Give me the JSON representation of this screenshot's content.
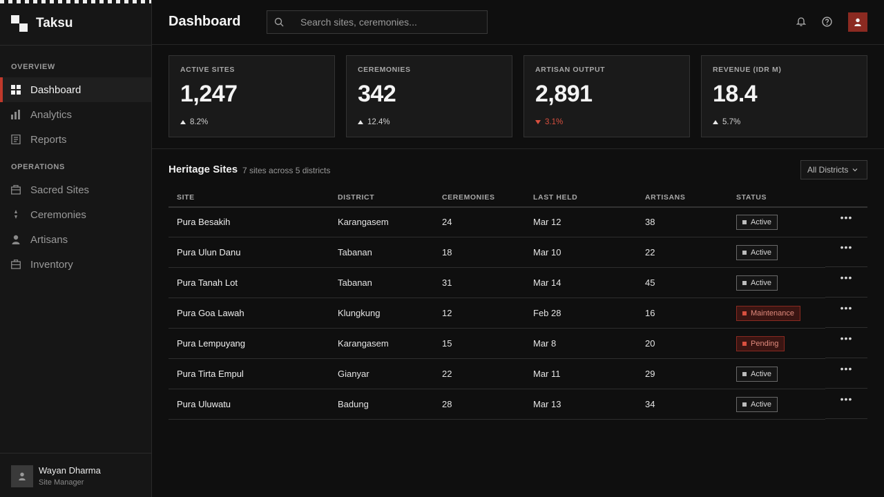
{
  "brand": {
    "name": "Taksu"
  },
  "nav": {
    "overview_label": "OVERVIEW",
    "operations_label": "OPERATIONS",
    "items": [
      {
        "label": "Dashboard",
        "icon": "grid-icon",
        "active": true
      },
      {
        "label": "Analytics",
        "icon": "bar-chart-icon"
      },
      {
        "label": "Reports",
        "icon": "document-icon"
      },
      {
        "label": "Sacred Sites",
        "icon": "temple-icon"
      },
      {
        "label": "Ceremonies",
        "icon": "flame-icon"
      },
      {
        "label": "Artisans",
        "icon": "person-icon"
      },
      {
        "label": "Inventory",
        "icon": "box-icon"
      }
    ]
  },
  "user": {
    "name": "Wayan Dharma",
    "role": "Site Manager"
  },
  "header": {
    "title": "Dashboard",
    "search_placeholder": "Search sites, ceremonies..."
  },
  "kpis": [
    {
      "label": "ACTIVE SITES",
      "value": "1,247",
      "delta": "8.2%",
      "direction": "up"
    },
    {
      "label": "CEREMONIES",
      "value": "342",
      "delta": "12.4%",
      "direction": "up"
    },
    {
      "label": "ARTISAN OUTPUT",
      "value": "2,891",
      "delta": "3.1%",
      "direction": "down"
    },
    {
      "label": "REVENUE (IDR M)",
      "value": "18.4",
      "delta": "5.7%",
      "direction": "up"
    }
  ],
  "table": {
    "title": "Heritage Sites",
    "subtitle": "7 sites across 5 districts",
    "filter_label": "All Districts",
    "columns": [
      "SITE",
      "DISTRICT",
      "CEREMONIES",
      "LAST HELD",
      "ARTISANS",
      "STATUS"
    ],
    "rows": [
      {
        "site": "Pura Besakih",
        "district": "Karangasem",
        "ceremonies": "24",
        "last_held": "Mar 12",
        "artisans": "38",
        "status": "Active"
      },
      {
        "site": "Pura Ulun Danu",
        "district": "Tabanan",
        "ceremonies": "18",
        "last_held": "Mar 10",
        "artisans": "22",
        "status": "Active"
      },
      {
        "site": "Pura Tanah Lot",
        "district": "Tabanan",
        "ceremonies": "31",
        "last_held": "Mar 14",
        "artisans": "45",
        "status": "Active"
      },
      {
        "site": "Pura Goa Lawah",
        "district": "Klungkung",
        "ceremonies": "12",
        "last_held": "Feb 28",
        "artisans": "16",
        "status": "Maintenance"
      },
      {
        "site": "Pura Lempuyang",
        "district": "Karangasem",
        "ceremonies": "15",
        "last_held": "Mar 8",
        "artisans": "20",
        "status": "Pending"
      },
      {
        "site": "Pura Tirta Empul",
        "district": "Gianyar",
        "ceremonies": "22",
        "last_held": "Mar 11",
        "artisans": "29",
        "status": "Active"
      },
      {
        "site": "Pura Uluwatu",
        "district": "Badung",
        "ceremonies": "28",
        "last_held": "Mar 13",
        "artisans": "34",
        "status": "Active"
      }
    ]
  },
  "colors": {
    "accent": "#c0392b",
    "warn_bg": "#3a1512"
  }
}
